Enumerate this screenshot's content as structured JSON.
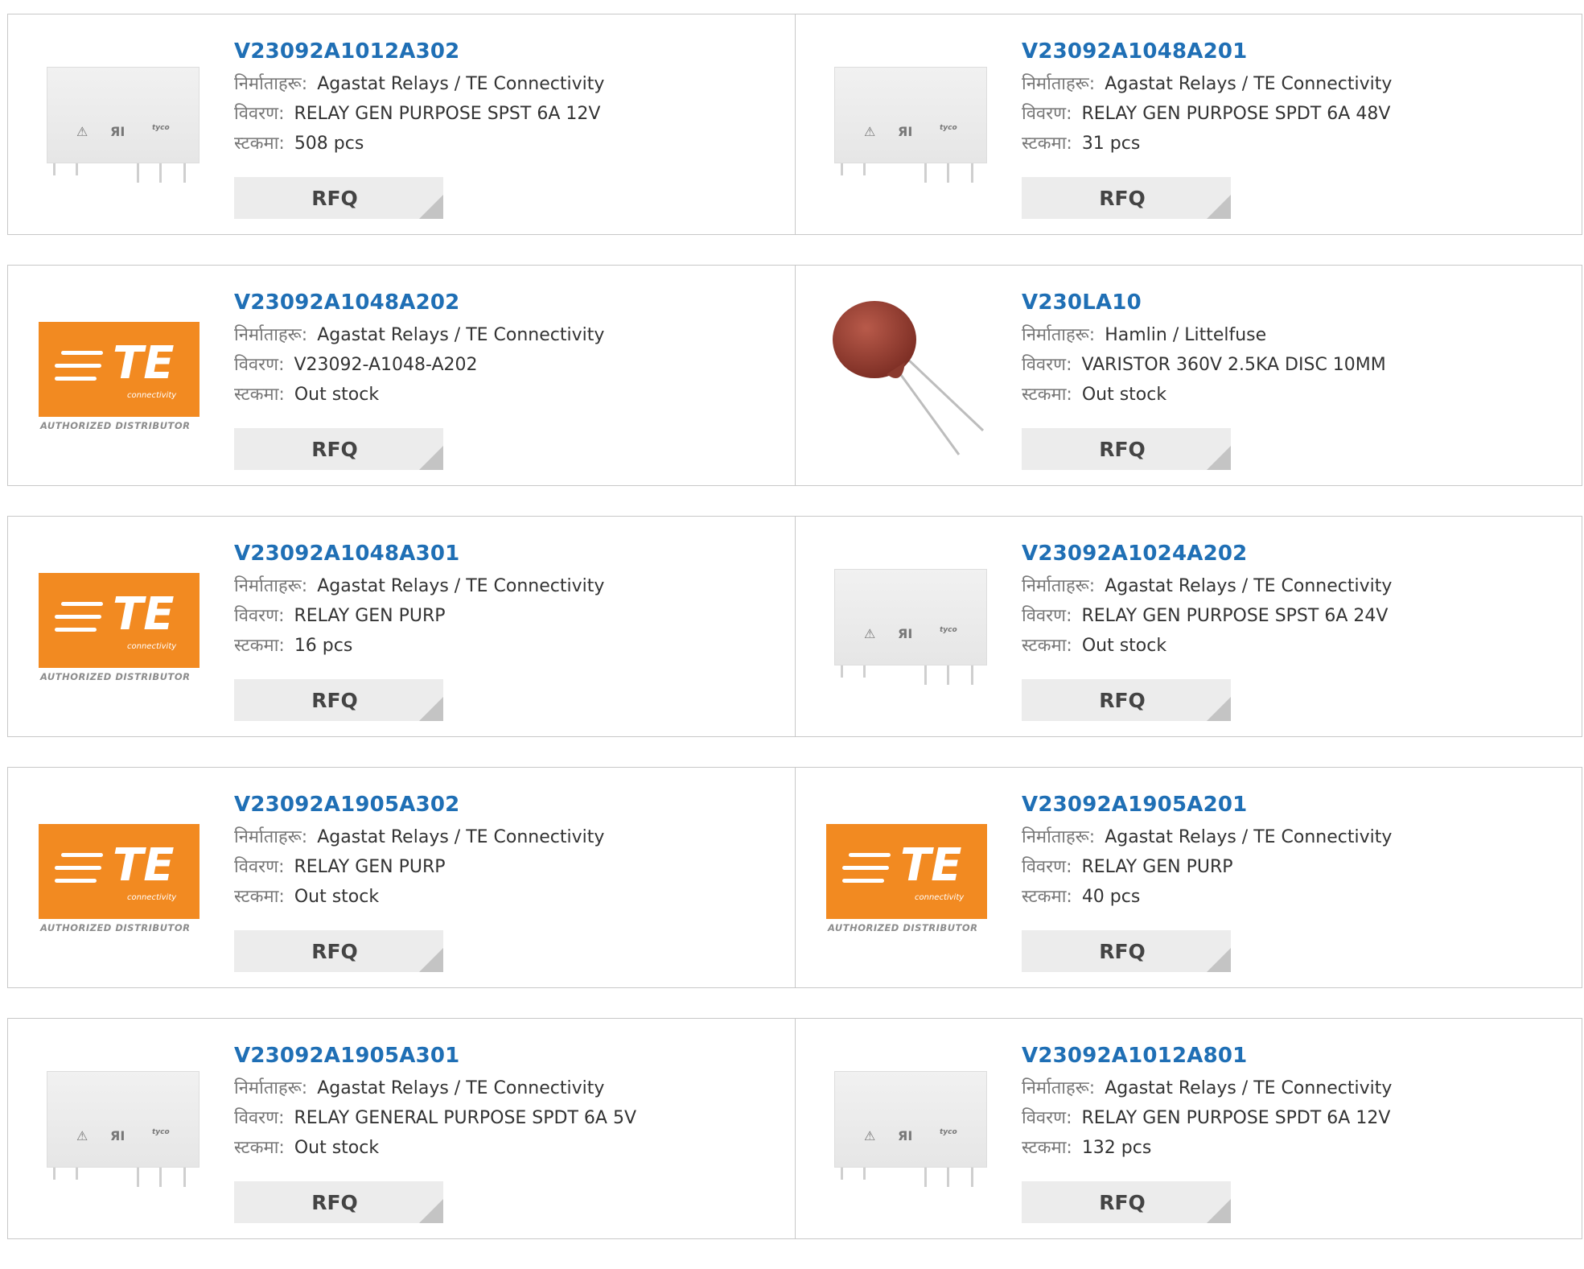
{
  "labels": {
    "manufacturer": "निर्माताहरू:",
    "description": "विवरण:",
    "stock": "स्टकमा:",
    "rfq": "RFQ"
  },
  "rows": [
    [
      {
        "part": "V23092A1012A302",
        "manufacturer": "Agastat Relays / TE Connectivity",
        "description": "RELAY GEN PURPOSE SPST 6A 12V",
        "stock": "508 pcs",
        "image": "relay"
      },
      {
        "part": "V23092A1048A201",
        "manufacturer": "Agastat Relays / TE Connectivity",
        "description": "RELAY GEN PURPOSE SPDT 6A 48V",
        "stock": "31 pcs",
        "image": "relay"
      }
    ],
    [
      {
        "part": "V23092A1048A202",
        "manufacturer": "Agastat Relays / TE Connectivity",
        "description": "V23092-A1048-A202",
        "stock": "Out stock",
        "image": "te-logo"
      },
      {
        "part": "V230LA10",
        "manufacturer": "Hamlin / Littelfuse",
        "description": "VARISTOR 360V 2.5KA DISC 10MM",
        "stock": "Out stock",
        "image": "varistor"
      }
    ],
    [
      {
        "part": "V23092A1048A301",
        "manufacturer": "Agastat Relays / TE Connectivity",
        "description": "RELAY GEN PURP",
        "stock": "16 pcs",
        "image": "te-logo"
      },
      {
        "part": "V23092A1024A202",
        "manufacturer": "Agastat Relays / TE Connectivity",
        "description": "RELAY GEN PURPOSE SPST 6A 24V",
        "stock": "Out stock",
        "image": "relay"
      }
    ],
    [
      {
        "part": "V23092A1905A302",
        "manufacturer": "Agastat Relays / TE Connectivity",
        "description": "RELAY GEN PURP",
        "stock": "Out stock",
        "image": "te-logo"
      },
      {
        "part": "V23092A1905A201",
        "manufacturer": "Agastat Relays / TE Connectivity",
        "description": "RELAY GEN PURP",
        "stock": "40 pcs",
        "image": "te-logo"
      }
    ],
    [
      {
        "part": "V23092A1905A301",
        "manufacturer": "Agastat Relays / TE Connectivity",
        "description": "RELAY GENERAL PURPOSE SPDT 6A 5V",
        "stock": "Out stock",
        "image": "relay"
      },
      {
        "part": "V23092A1012A801",
        "manufacturer": "Agastat Relays / TE Connectivity",
        "description": "RELAY GEN PURPOSE SPDT 6A 12V",
        "stock": "132 pcs",
        "image": "relay"
      }
    ]
  ],
  "te_logo": {
    "word": "TE",
    "sub": "connectivity",
    "tagline": "AUTHORIZED DISTRIBUTOR"
  },
  "relay_marks": {
    "ul": "ЯI",
    "brand": "tyco"
  },
  "colors": {
    "link": "#1f6fb5",
    "te_orange": "#f28a21",
    "rfq_bg": "#ececec",
    "border": "#c8c8c8"
  }
}
